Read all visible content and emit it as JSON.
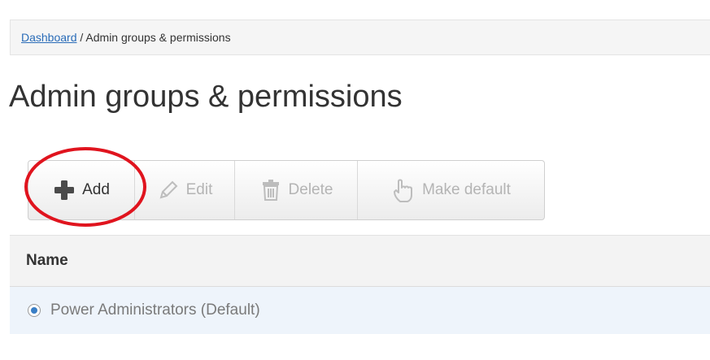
{
  "breadcrumb": {
    "link": "Dashboard",
    "separator": " / ",
    "current": "Admin groups & permissions"
  },
  "page": {
    "title": "Admin groups & permissions"
  },
  "toolbar": {
    "add_label": "Add",
    "edit_label": "Edit",
    "delete_label": "Delete",
    "make_default_label": "Make default",
    "add_icon": "plus-icon",
    "edit_icon": "pencil-icon",
    "delete_icon": "trash-icon",
    "make_default_icon": "hand-pointer-icon",
    "highlight_color": "#e0141e"
  },
  "table": {
    "columns": [
      "Name"
    ],
    "rows": [
      {
        "name": "Power Administrators (Default)",
        "selected": true
      }
    ]
  }
}
